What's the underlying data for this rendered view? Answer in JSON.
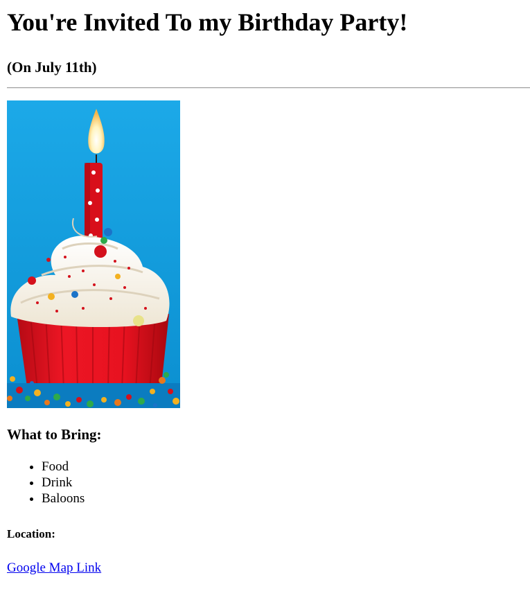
{
  "header": {
    "title": "You're Invited To my Birthday Party!",
    "date": "(On July 11th)"
  },
  "image": {
    "subject": "cupcake-with-candle-icon",
    "colors": {
      "background": "#1aa7e6",
      "cup": "#e01020",
      "frosting": "#fbf6ec",
      "candle": "#e0101c",
      "flame": "#fff6c8"
    }
  },
  "bring": {
    "heading": "What to Bring:",
    "items": [
      "Food",
      "Drink",
      "Baloons"
    ]
  },
  "location": {
    "heading": "Location:",
    "link_label": "Google Map Link"
  },
  "colors": {
    "link": "#0000ee",
    "text": "#000000",
    "divider": "#9a9a9a"
  }
}
